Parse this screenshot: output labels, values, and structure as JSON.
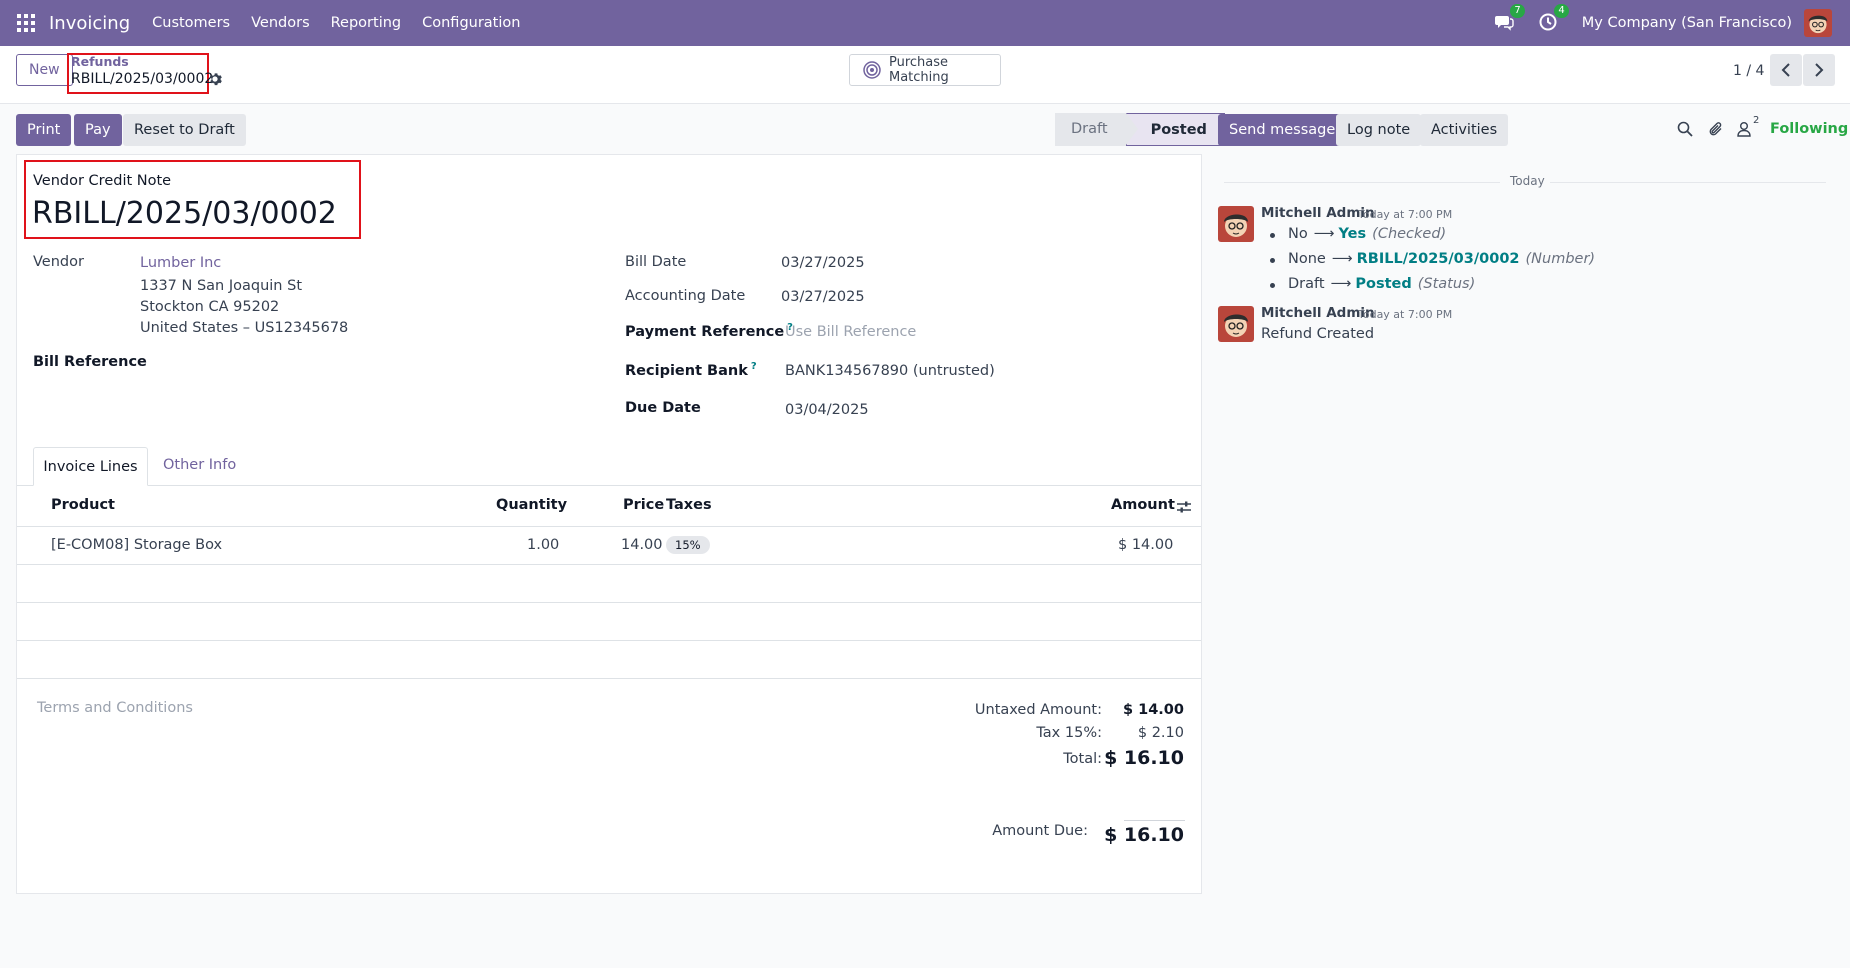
{
  "navbar": {
    "app_name": "Invoicing",
    "menu": [
      "Customers",
      "Vendors",
      "Reporting",
      "Configuration"
    ],
    "messages_count": "7",
    "activities_count": "4",
    "company": "My Company (San Francisco)"
  },
  "control_panel": {
    "new_label": "New",
    "breadcrumb_parent": "Refunds",
    "breadcrumb_current": "RBILL/2025/03/0002",
    "purchase_matching_label": "Purchase Matching",
    "pager": "1 / 4"
  },
  "actions": {
    "print": "Print",
    "pay": "Pay",
    "reset": "Reset to Draft"
  },
  "status": {
    "steps": [
      "Draft",
      "Posted"
    ],
    "current": "Posted"
  },
  "form": {
    "doc_type": "Vendor Credit Note",
    "number": "RBILL/2025/03/0002",
    "vendor_label": "Vendor",
    "vendor_name": "Lumber Inc",
    "vendor_address": [
      "1337 N San Joaquin St",
      "Stockton CA 95202",
      "United States – US12345678"
    ],
    "bill_reference_label": "Bill Reference",
    "bill_date_label": "Bill Date",
    "bill_date": "03/27/2025",
    "accounting_date_label": "Accounting Date",
    "accounting_date": "03/27/2025",
    "payment_reference_label": "Payment Reference",
    "payment_reference_placeholder": "Use Bill Reference",
    "recipient_bank_label": "Recipient Bank",
    "recipient_bank": "BANK134567890 (untrusted)",
    "due_date_label": "Due Date",
    "due_date": "03/04/2025",
    "help_mark": "?"
  },
  "tabs": [
    "Invoice Lines",
    "Other Info"
  ],
  "table": {
    "headers": {
      "product": "Product",
      "quantity": "Quantity",
      "price": "Price",
      "taxes": "Taxes",
      "amount": "Amount"
    },
    "rows": [
      {
        "product": "[E-COM08] Storage Box",
        "quantity": "1.00",
        "price": "14.00",
        "tax": "15%",
        "amount": "$ 14.00"
      }
    ]
  },
  "terms_placeholder": "Terms and Conditions",
  "totals": {
    "untaxed_label": "Untaxed Amount:",
    "untaxed": "$ 14.00",
    "tax_label": "Tax 15%:",
    "tax": "$ 2.10",
    "total_label": "Total:",
    "total": "$ 16.10",
    "due_label": "Amount Due:",
    "due": "$ 16.10"
  },
  "chatter": {
    "send_message": "Send message",
    "log_note": "Log note",
    "activities": "Activities",
    "followers_count": "2",
    "following": "Following",
    "date_separator": "Today",
    "messages": [
      {
        "author": "Mitchell Admin",
        "time": "Today at 7:00 PM",
        "tracking": [
          {
            "old": "No",
            "new": "Yes",
            "field": "(Checked)"
          },
          {
            "old": "None",
            "new": "RBILL/2025/03/0002",
            "field": "(Number)"
          },
          {
            "old": "Draft",
            "new": "Posted",
            "field": "(Status)"
          }
        ]
      },
      {
        "author": "Mitchell Admin",
        "time": "Today at 7:00 PM",
        "body": "Refund Created"
      }
    ]
  },
  "colors": {
    "brand": "#71639e",
    "link_teal": "#017e84",
    "success": "#28a745",
    "highlight_box": "#e0121a"
  }
}
